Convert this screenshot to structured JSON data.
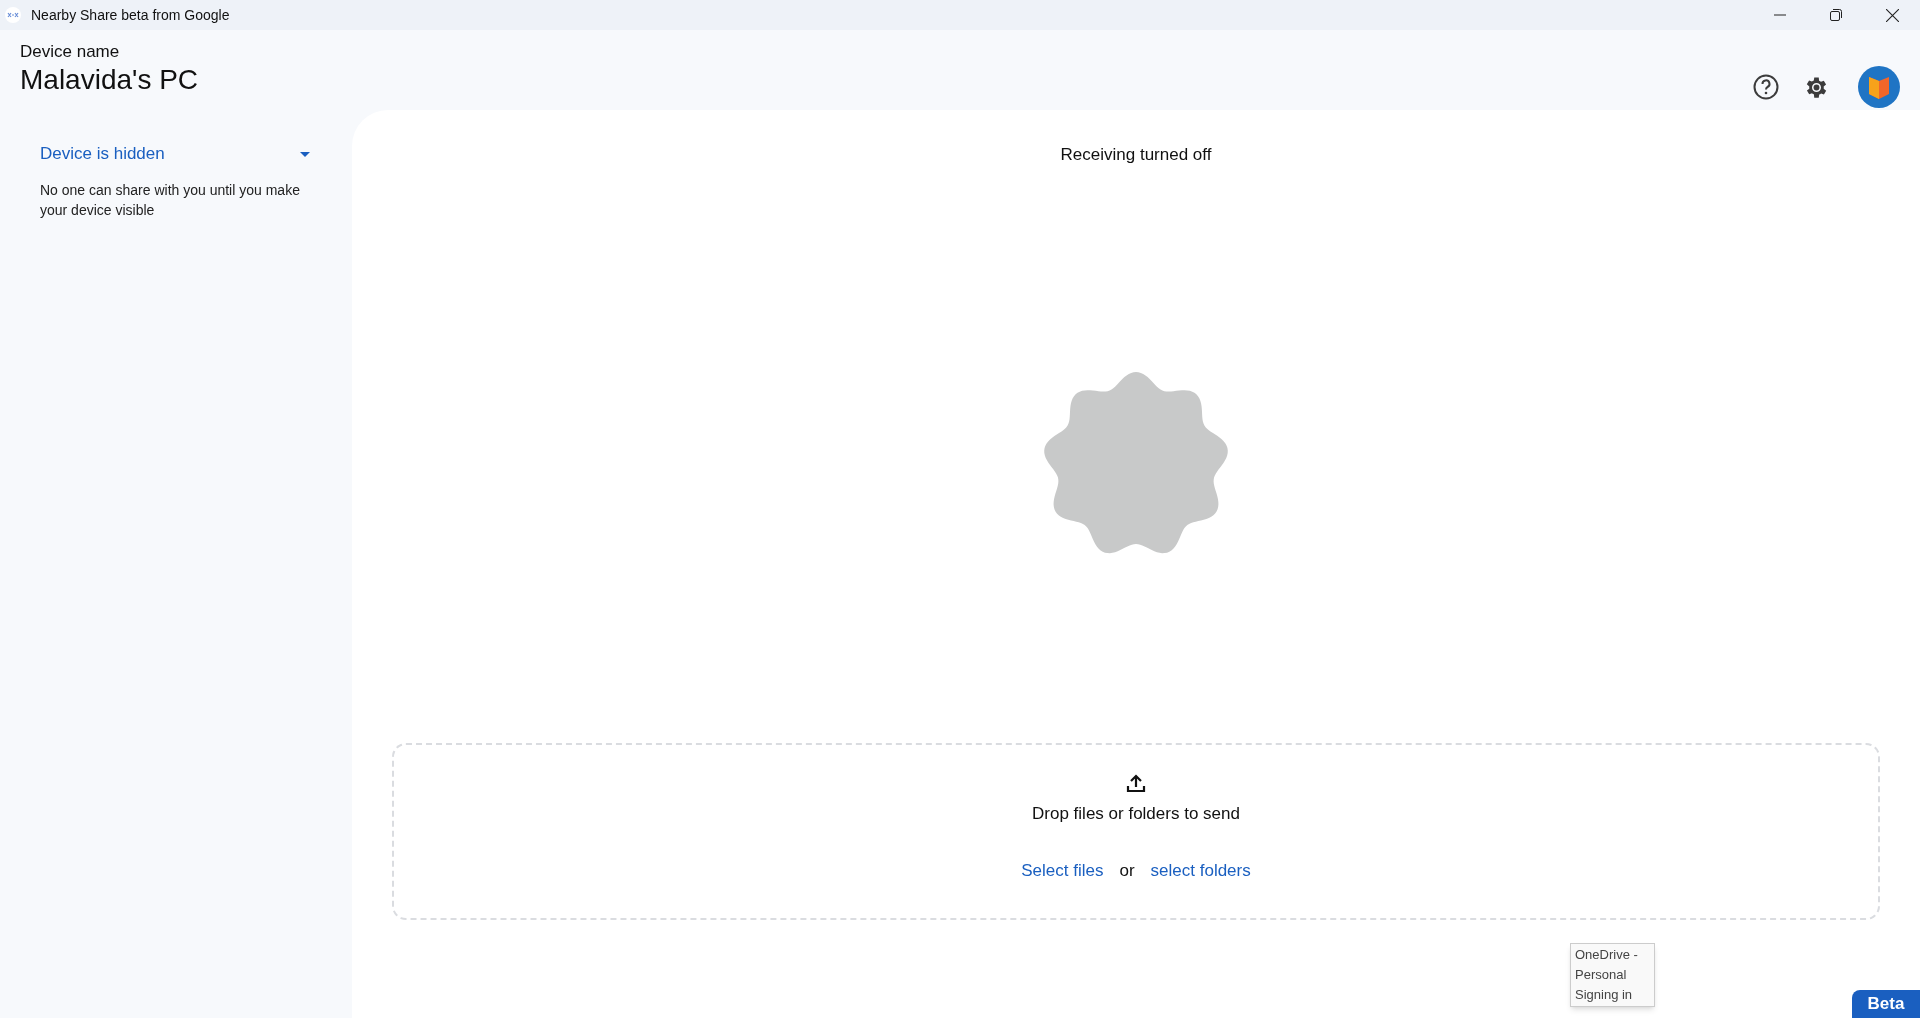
{
  "window": {
    "title": "Nearby Share beta from Google"
  },
  "header": {
    "label": "Device name",
    "device_name": "Malavida's PC"
  },
  "sidebar": {
    "visibility": {
      "label": "Device is hidden",
      "expanded": false
    },
    "description": "No one can share with you until you make your device visible"
  },
  "main": {
    "status": "Receiving turned off"
  },
  "drop_zone": {
    "prompt": "Drop files or folders to send",
    "select_files": "Select files",
    "separator": "or",
    "select_folders": "select folders"
  },
  "tooltip": {
    "lines": [
      "OneDrive -",
      "Personal",
      "Signing in"
    ]
  },
  "badge": "Beta"
}
